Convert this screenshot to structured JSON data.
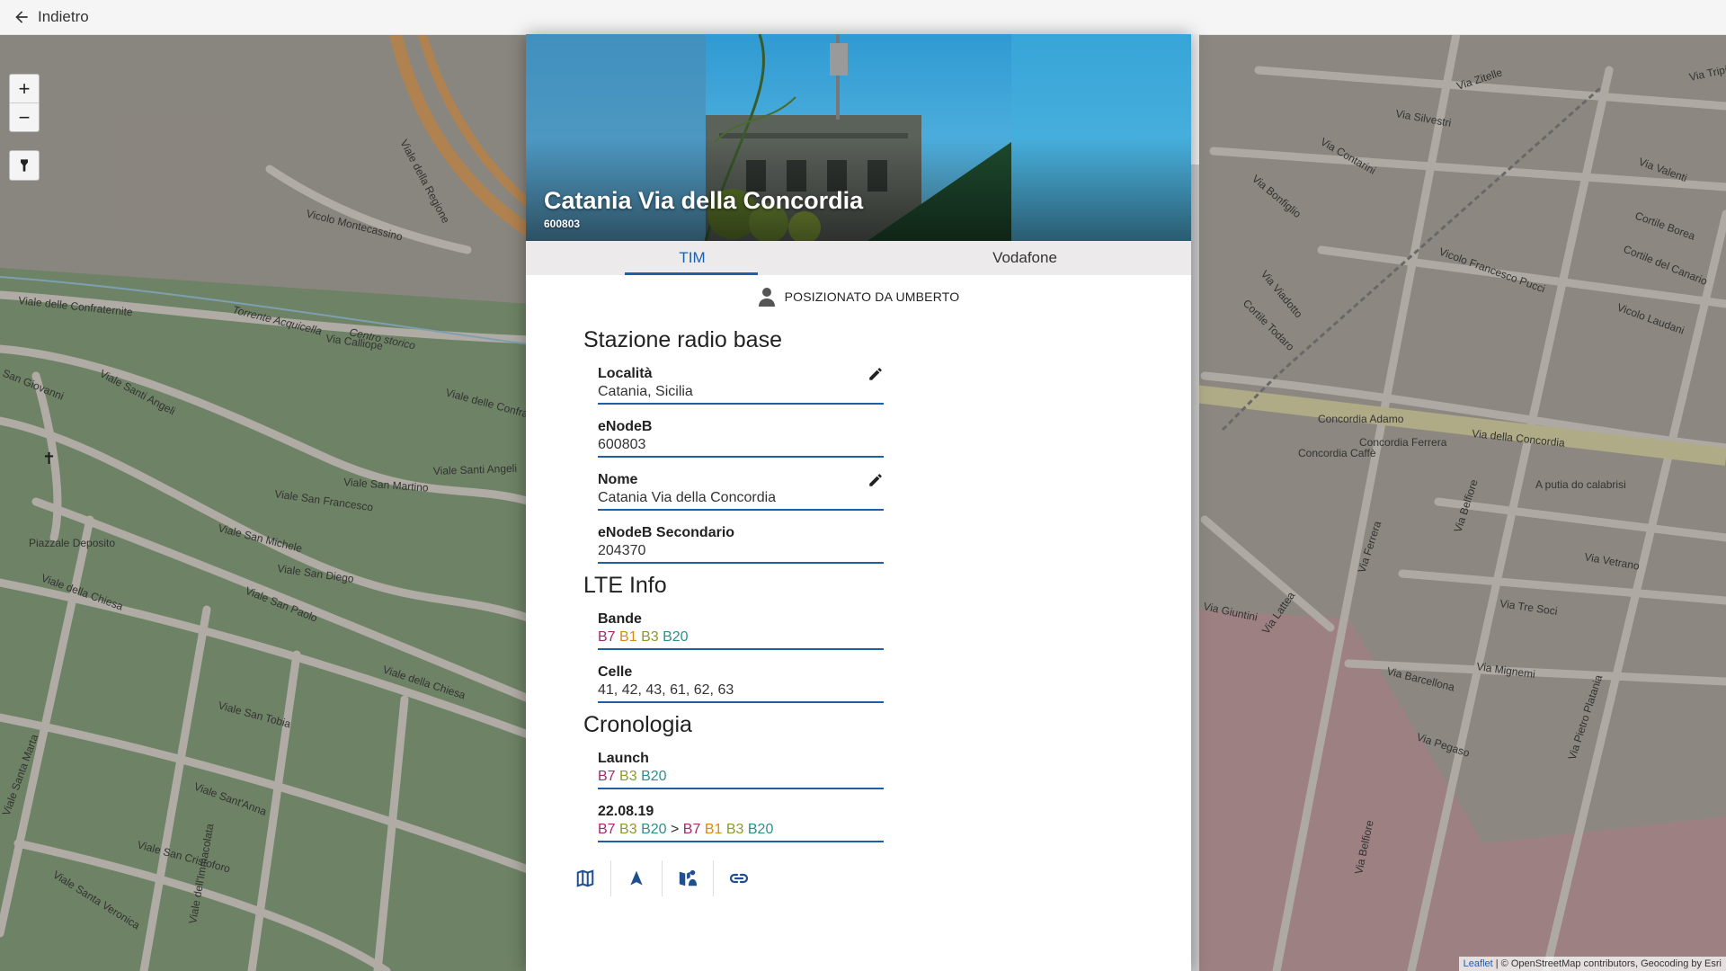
{
  "topbar": {
    "back_label": "Indietro",
    "back_icon": "arrow-left-icon"
  },
  "map": {
    "zoom_in": "+",
    "zoom_out": "−",
    "locate_icon": "flashlight-icon",
    "attribution": {
      "leaflet": "Leaflet",
      "rest": " | © OpenStreetMap contributors, Geocoding by Esri"
    },
    "labels": {
      "l1": "Viale della Regione",
      "l2": "Vicolo Montecassino",
      "l3": "Viale delle Confraternite",
      "l4": "Via Calliope",
      "l5": "Torrente Acquicella",
      "l6": "Centro storico",
      "l7": "San Giovanni",
      "l8": "Viale Santi Angeli",
      "l9": "Viale delle Confraternite",
      "l10": "Viale San Martino",
      "l11": "Viale San Francesco",
      "l12": "Viale Santi Angeli",
      "l13": "Piazzale Deposito",
      "l14": "Viale San Michele",
      "l15": "Viale San Diego",
      "l16": "Viale della Chiesa",
      "l17": "Viale San Paolo",
      "l18": "Viale della Chiesa",
      "l19": "Viale San Tobia",
      "l20": "Viale Sant'Anna",
      "l21": "Viale San Cristoforo",
      "l22": "Viale Santa Veronica",
      "l23": "Viale Santa Marta",
      "l24": "Viale dell'Immacolata",
      "r1": "Via Zitelle",
      "r2": "Via Silvestri",
      "r3": "Via Contarini",
      "r4": "Via Bonfiglio",
      "r5": "Via Valenti",
      "r6": "Cortile Borea",
      "r7": "Cortile del Canario",
      "r8": "Vicolo Francesco Pucci",
      "r9": "Vicolo Laudani",
      "r10": "Cortile Todaro",
      "r11": "Via Viadotto",
      "r12": "Via della Concordia",
      "r13": "Concordia Caffè",
      "r14": "Concordia Adamo",
      "r15": "Concordia Ferrera",
      "r16": "A putia do calabrisi",
      "r17": "Via Belfiore",
      "r18": "Via Ferrera",
      "r19": "Via Vetrano",
      "r20": "Via Tre Soci",
      "r21": "Via Lattea",
      "r22": "Via Mignemi",
      "r23": "Via Barcellona",
      "r24": "Via Pegaso",
      "r25": "Via Pietro Platania",
      "r26": "Via Belfiore",
      "r27": "Via Giuntini",
      "r28": "Via Tripi"
    }
  },
  "site": {
    "title": "Catania Via della Concordia",
    "id": "600803",
    "tabs": [
      {
        "label": "TIM",
        "active": true
      },
      {
        "label": "Vodafone",
        "active": false
      }
    ],
    "positioned_by": "POSIZIONATO DA UMBERTO",
    "sections": {
      "srb": {
        "title": "Stazione radio base",
        "location_label": "Località",
        "location_value": "Catania, Sicilia",
        "enodeb_label": "eNodeB",
        "enodeb_value": "600803",
        "name_label": "Nome",
        "name_value": "Catania Via della Concordia",
        "secondary_label": "eNodeB Secondario",
        "secondary_value": "204370"
      },
      "lte": {
        "title": "LTE Info",
        "bands_label": "Bande",
        "bands": [
          "B7",
          "B1",
          "B3",
          "B20"
        ],
        "cells_label": "Celle",
        "cells_value": "41, 42, 43, 61, 62, 63"
      },
      "history": {
        "title": "Cronologia",
        "launch_label": "Launch",
        "launch_bands": [
          "B7",
          "B3",
          "B20"
        ],
        "update_label": "22.08.19",
        "update_from": [
          "B7",
          "B3",
          "B20"
        ],
        "update_arrow": ">",
        "update_to": [
          "B7",
          "B1",
          "B3",
          "B20"
        ]
      }
    },
    "actions": [
      "map-icon",
      "navigation-icon",
      "street-view-icon",
      "link-icon"
    ]
  },
  "colors": {
    "accent": "#1f5fa6",
    "band_B7": "#a12a6e",
    "band_B1": "#d98a15",
    "band_B3": "#8c9a2b",
    "band_B20": "#2c8f8a"
  }
}
